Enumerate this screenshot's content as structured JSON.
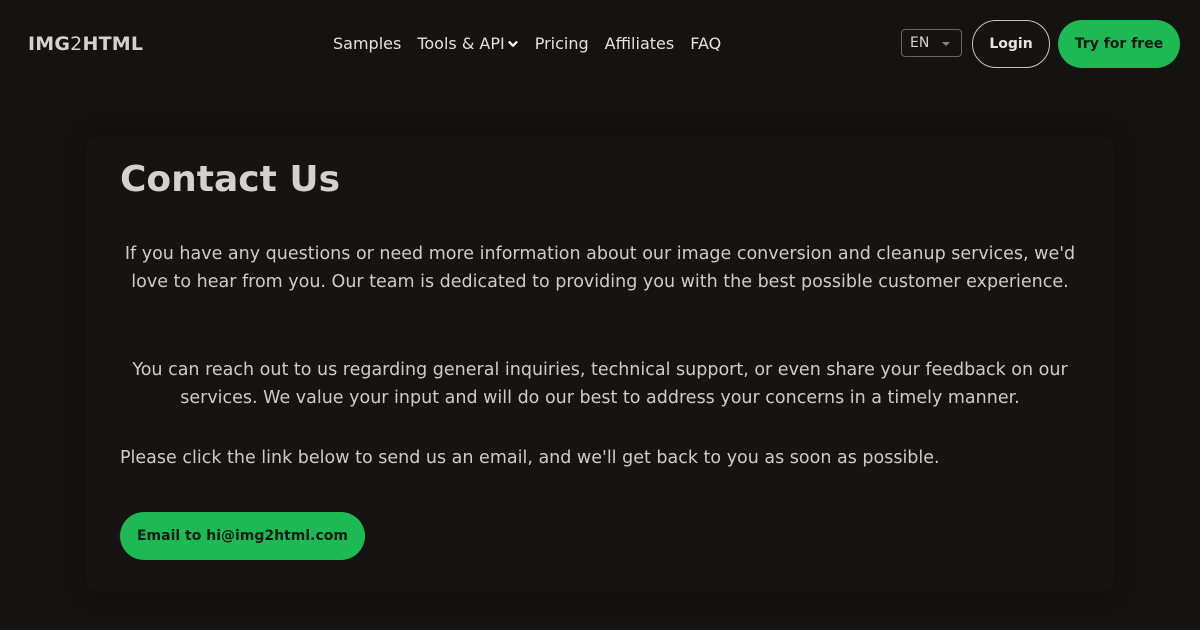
{
  "header": {
    "logo_prefix": "IMG",
    "logo_two": "2",
    "logo_suffix": "HTML",
    "nav": [
      {
        "label": "Samples"
      },
      {
        "label": "Tools & API",
        "icon": "chevron-down-icon"
      },
      {
        "label": "Pricing"
      },
      {
        "label": "Affiliates"
      },
      {
        "label": "FAQ"
      }
    ],
    "language": "EN",
    "login_label": "Login",
    "try_label": "Try for free"
  },
  "main": {
    "title": "Contact Us",
    "paragraph1": "If you have any questions or need more information about our image conversion and cleanup services, we'd love to hear from you. Our team is dedicated to providing you with the best possible customer experience.",
    "paragraph2": "You can reach out to us regarding general inquiries, technical support, or even share your feedback on our services. We value your input and will do our best to address your concerns in a timely manner.",
    "paragraph3": "Please click the link below to send us an email, and we'll get back to you as soon as possible.",
    "email_button": "Email to hi@img2html.com"
  },
  "colors": {
    "background": "#151212",
    "accent": "#1db954",
    "text": "#d7d4d3"
  }
}
